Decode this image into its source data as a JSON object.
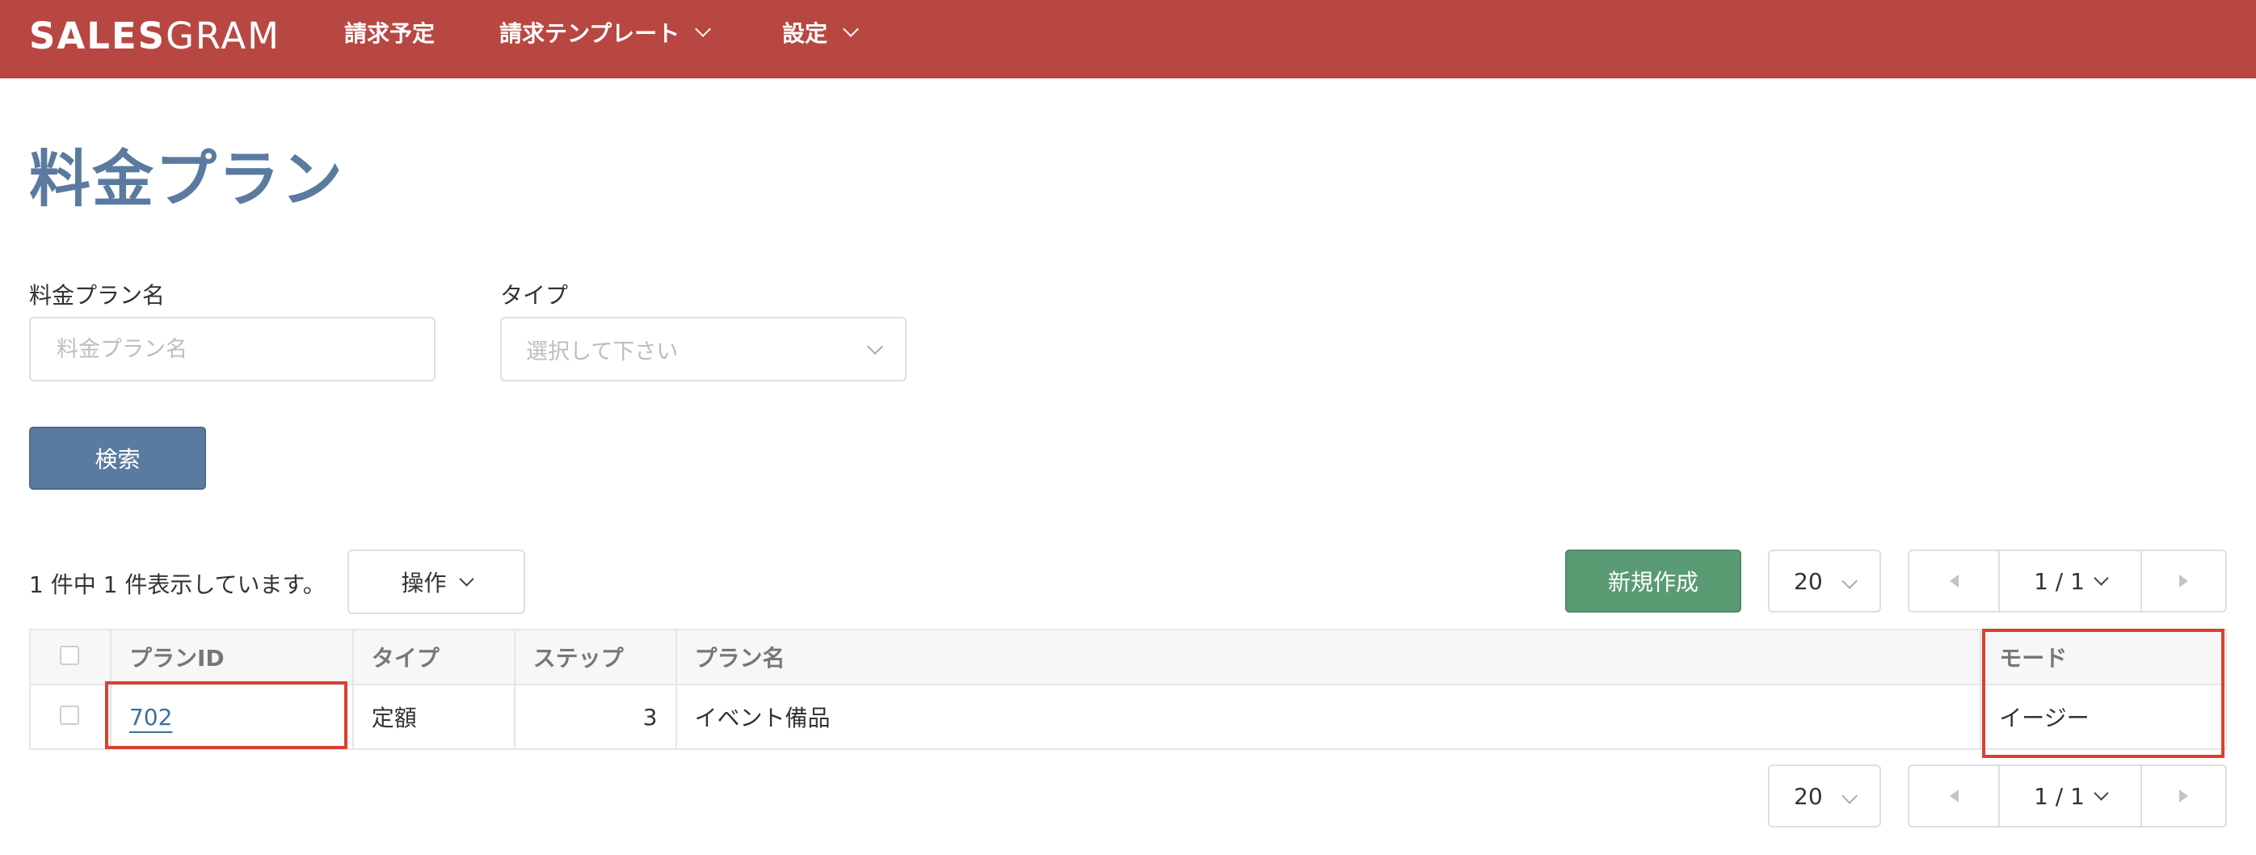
{
  "header": {
    "logo_bold": "SALES",
    "logo_light": "GRAM",
    "nav": [
      {
        "label": "請求予定"
      },
      {
        "label": "請求テンプレート"
      },
      {
        "label": "設定"
      }
    ]
  },
  "page": {
    "title": "料金プラン"
  },
  "filters": {
    "plan_name": {
      "label": "料金プラン名",
      "placeholder": "料金プラン名",
      "value": ""
    },
    "type": {
      "label": "タイプ",
      "placeholder": "選択して下さい"
    },
    "search_label": "検索"
  },
  "toolbar": {
    "count_text": "1 件中 1 件表示しています。",
    "actions_label": "操作",
    "new_label": "新規作成",
    "per_page": "20",
    "page_label": "1 / 1"
  },
  "table": {
    "columns": [
      "プランID",
      "タイプ",
      "ステップ",
      "プラン名",
      "モード"
    ],
    "rows": [
      {
        "id": "702",
        "type": "定額",
        "step": "3",
        "name": "イベント備品",
        "mode": "イージー"
      }
    ]
  },
  "footer_pager": {
    "per_page": "20",
    "page_label": "1 / 1"
  },
  "colors": {
    "header_bg": "#b84742",
    "title": "#5b7aa0",
    "search_btn": "#5b7aa0",
    "new_btn": "#5b9b73",
    "highlight": "#d9412f"
  }
}
